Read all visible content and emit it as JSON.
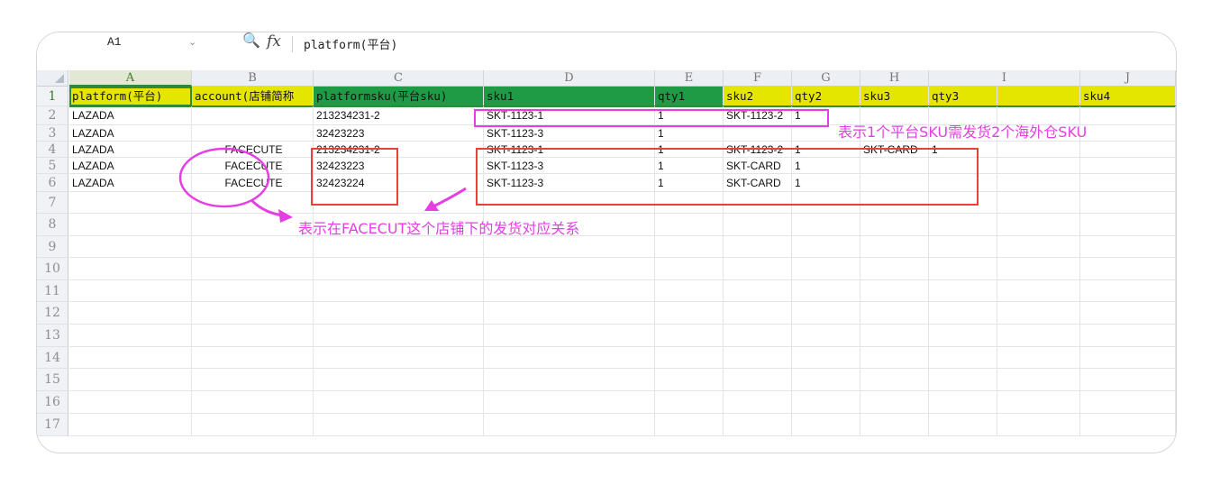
{
  "formula_bar": {
    "name_box": "A1",
    "dropdown_icon": "chevron-down-icon",
    "zoom_icon": "zoom-icon",
    "fx_label": "fx",
    "formula": "platform(平台)"
  },
  "columns": [
    "A",
    "B",
    "C",
    "D",
    "E",
    "F",
    "G",
    "H",
    "I",
    "J"
  ],
  "rows": [
    "1",
    "2",
    "3",
    "4",
    "5",
    "6",
    "7",
    "8",
    "9",
    "10",
    "11",
    "12",
    "13",
    "14",
    "15",
    "16",
    "17"
  ],
  "header_row": [
    "platform(平台)",
    "account(店铺简称",
    "platformsku(平台sku)",
    "sku1",
    "qty1",
    "sku2",
    "qty2",
    "sku3",
    "qty3",
    "",
    "sku4"
  ],
  "data_rows": [
    [
      "LAZADA",
      "",
      "213234231-2",
      "SKT-1123-1",
      "1",
      "SKT-1123-2",
      "1",
      "",
      "",
      "",
      ""
    ],
    [
      "LAZADA",
      "",
      "32423223",
      "SKT-1123-3",
      "1",
      "",
      "",
      "",
      "",
      "",
      ""
    ],
    [
      "LAZADA",
      "FACECUTE",
      "213234231-2",
      "SKT-1123-1",
      "1",
      "SKT-1123-2",
      "1",
      "SKT-CARD",
      "1",
      "",
      ""
    ],
    [
      "LAZADA",
      "FACECUTE",
      "32423223",
      "SKT-1123-3",
      "1",
      "SKT-CARD",
      "1",
      "",
      "",
      "",
      ""
    ],
    [
      "LAZADA",
      "FACECUTE",
      "32423224",
      "SKT-1123-3",
      "1",
      "SKT-CARD",
      "1",
      "",
      "",
      "",
      ""
    ]
  ],
  "annotations": {
    "top_note": "表示1个平台SKU需发货2个海外仓SKU",
    "bottom_note": "表示在FACECUT这个店铺下的发货对应关系"
  },
  "colors": {
    "header_yellow": "#e5e600",
    "header_green": "#1f9a45",
    "annotation_magenta": "#e53ee3",
    "box_red": "#e8403a"
  }
}
